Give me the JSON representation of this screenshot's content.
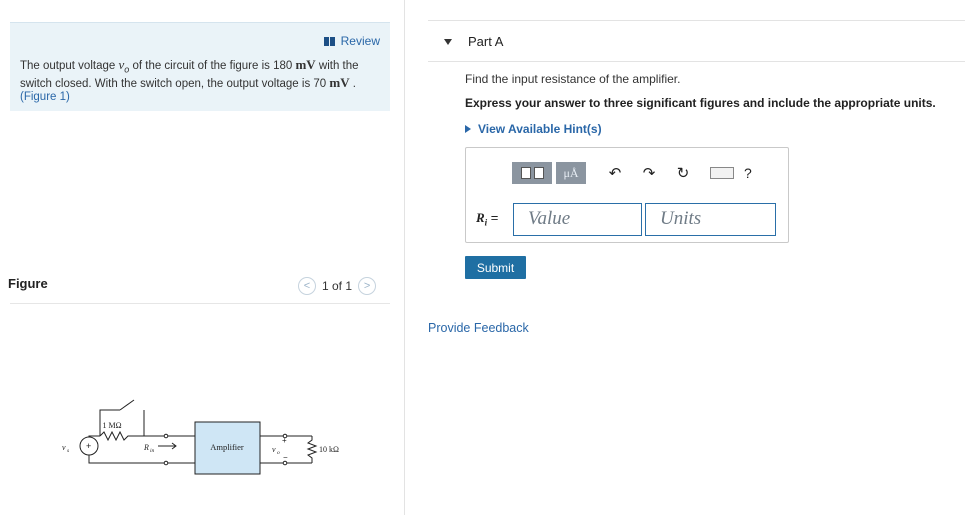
{
  "problem": {
    "review_label": "Review",
    "text_part1": "The output voltage ",
    "vo_symbol": "v",
    "vo_sub": "o",
    "text_part2": " of the circuit of the figure is 180 ",
    "unit_mv_1": "mV",
    "text_part3": " with the switch closed. With the switch open, the output voltage is 70 ",
    "unit_mv_2": "mV",
    "text_part4": " .",
    "figure_link": "(Figure 1)"
  },
  "figure": {
    "label": "Figure",
    "pager_text": "1 of 1",
    "prev_icon": "chevron-left-icon",
    "next_icon": "chevron-right-icon",
    "circuit": {
      "resistor_label": "1 MΩ",
      "rin_label": "R",
      "rin_sub": "in",
      "amplifier_label": "Amplifier",
      "vo_label": "v",
      "vo_sub": "o",
      "load_label": "10 kΩ",
      "source_label": "v",
      "source_sub": "s"
    }
  },
  "part": {
    "title": "Part A",
    "question": "Find the input resistance of the amplifier.",
    "instruction": "Express your answer to three significant figures and include the appropriate units.",
    "hint_link": "View Available Hint(s)",
    "answer": {
      "label_var": "R",
      "label_sub": "i",
      "label_eq": " =",
      "value_placeholder": "Value",
      "units_placeholder": "Units",
      "toolbar": {
        "template_icon": "template-icon",
        "units_btn": "μÅ",
        "undo_icon": "undo-icon",
        "redo_icon": "redo-icon",
        "reset_icon": "reset-icon",
        "keyboard_icon": "keyboard-icon",
        "help": "?"
      }
    },
    "submit_label": "Submit"
  },
  "feedback_link": "Provide Feedback"
}
